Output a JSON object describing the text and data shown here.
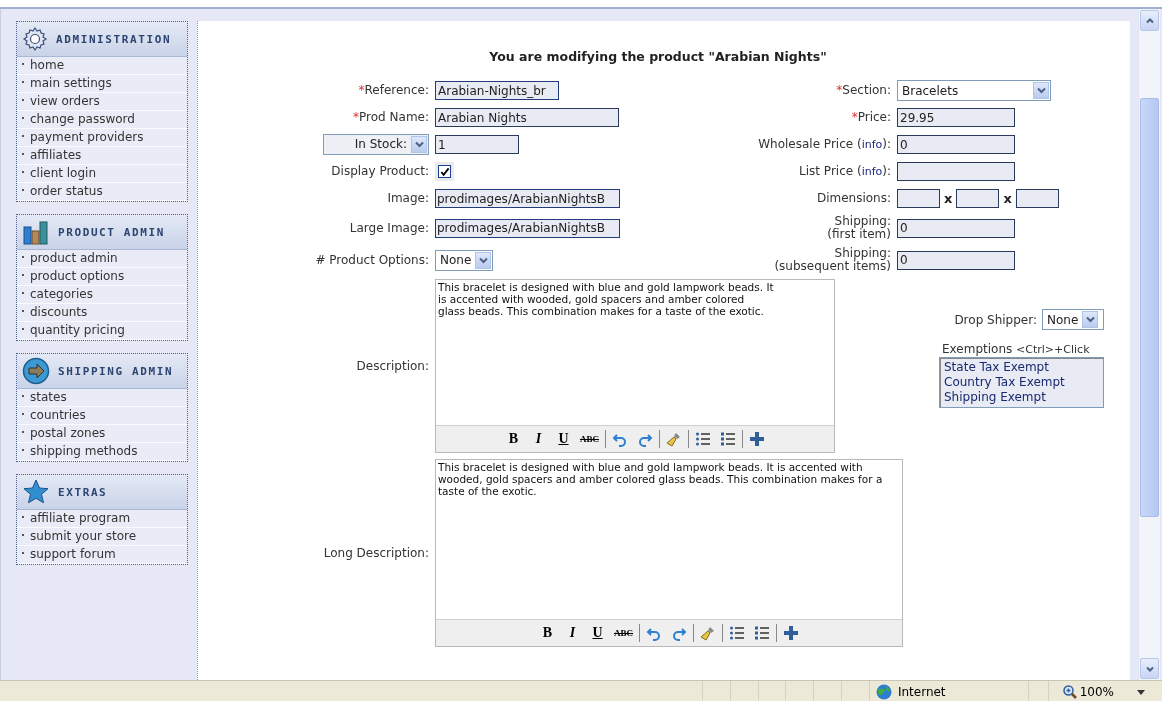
{
  "sidebar": {
    "sections": [
      {
        "title": "ADMINISTRATION",
        "items": [
          "home",
          "main settings",
          "view orders",
          "change password",
          "payment providers",
          "affiliates",
          "client login",
          "order status"
        ]
      },
      {
        "title": "PRODUCT ADMIN",
        "items": [
          "product admin",
          "product options",
          "categories",
          "discounts",
          "quantity pricing"
        ]
      },
      {
        "title": "SHIPPING ADMIN",
        "items": [
          "states",
          "countries",
          "postal zones",
          "shipping methods"
        ]
      },
      {
        "title": "EXTRAS",
        "items": [
          "affiliate program",
          "submit your store",
          "support forum"
        ]
      }
    ]
  },
  "page_title": "You are modifying the product \"Arabian Nights\"",
  "form": {
    "left": [
      {
        "kind": "text",
        "mark": "*",
        "label": "Reference:",
        "value": "Arabian-Nights_br"
      },
      {
        "kind": "text",
        "mark": "*",
        "label": "Prod Name:",
        "value": "Arabian Nights"
      },
      {
        "kind": "stock",
        "select": "In Stock:",
        "value": "1"
      },
      {
        "kind": "checkbox",
        "label": "Display Product:",
        "checked": true
      },
      {
        "kind": "text",
        "label": "Image:",
        "value": "prodimages/ArabianNightsB"
      },
      {
        "kind": "text",
        "label": "Large Image:",
        "value": "prodimages/ArabianNightsB"
      },
      {
        "kind": "select",
        "label": "# Product Options:",
        "value": "None"
      }
    ],
    "right": [
      {
        "kind": "select",
        "mark": "*",
        "label": "Section:",
        "value": "Bracelets"
      },
      {
        "kind": "text",
        "mark": "*",
        "label": "Price:",
        "value": "29.95"
      },
      {
        "kind": "text",
        "label": "Wholesale Price (",
        "link": "info",
        "label_end": "):",
        "value": "0"
      },
      {
        "kind": "text",
        "label": "List Price (",
        "link": "info",
        "label_end": "):"
      },
      {
        "kind": "dimensions",
        "label": "Dimensions:",
        "separators": [
          "x",
          "x"
        ]
      },
      {
        "kind": "text",
        "label": "Shipping:",
        "sublabel": "(first item)",
        "value": "0"
      },
      {
        "kind": "text",
        "label": "Shipping:",
        "sublabel": "(subsequent items)",
        "value": "0"
      }
    ]
  },
  "description": {
    "label": "Description:",
    "text": "This bracelet is designed with blue and gold lampwork beads. It is accented with wooded, gold spacers and amber colored glass beads. This combination makes for a taste of the exotic.",
    "toolbar": [
      {
        "kind": "bold",
        "label": "B"
      },
      {
        "kind": "italic",
        "label": "I"
      },
      {
        "kind": "underline",
        "label": "U"
      },
      {
        "kind": "strike",
        "label": "ABC"
      },
      {
        "kind": "separator"
      },
      {
        "kind": "undo"
      },
      {
        "kind": "redo"
      },
      {
        "kind": "separator"
      },
      {
        "kind": "clean"
      },
      {
        "kind": "separator"
      },
      {
        "kind": "bullets"
      },
      {
        "kind": "numbers"
      },
      {
        "kind": "separator"
      },
      {
        "kind": "insert"
      }
    ]
  },
  "drop_shipper": {
    "label": "Drop Shipper:",
    "value": "None"
  },
  "exemptions": {
    "label": "Exemptions",
    "hint": "<Ctrl>+Click",
    "options": [
      {
        "label": "State Tax Exempt",
        "selected": false
      },
      {
        "label": "Country Tax Exempt",
        "selected": false
      },
      {
        "label": "Shipping Exempt",
        "selected": false
      }
    ]
  },
  "long_description": {
    "label": "Long Description:",
    "text": "This bracelet is designed with blue and gold lampwork beads. It is accented with wooded, gold spacers and amber colored glass beads. This combination makes for a taste of the exotic.",
    "toolbar": [
      {
        "kind": "bold",
        "label": "B"
      },
      {
        "kind": "italic",
        "label": "I"
      },
      {
        "kind": "underline",
        "label": "U"
      },
      {
        "kind": "strike",
        "label": "ABC"
      },
      {
        "kind": "separator"
      },
      {
        "kind": "undo"
      },
      {
        "kind": "redo"
      },
      {
        "kind": "separator"
      },
      {
        "kind": "clean"
      },
      {
        "kind": "separator"
      },
      {
        "kind": "bullets"
      },
      {
        "kind": "numbers"
      },
      {
        "kind": "separator"
      },
      {
        "kind": "insert"
      }
    ]
  },
  "status_bar": {
    "zone": "Internet",
    "zoom": "100%"
  }
}
